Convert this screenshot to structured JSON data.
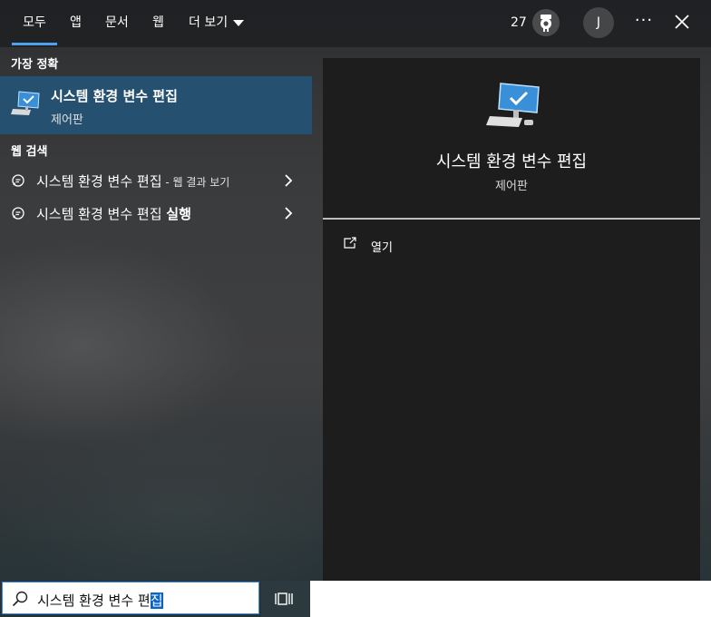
{
  "tabs": [
    {
      "label": "모두",
      "active": true
    },
    {
      "label": "앱"
    },
    {
      "label": "문서"
    },
    {
      "label": "웹"
    },
    {
      "label": "더 보기"
    }
  ],
  "header": {
    "points": "27",
    "avatar_initial": "J",
    "more_glyph": "···"
  },
  "best_match": {
    "section_title": "가장 정확",
    "name": "시스템 환경 변수 편집",
    "subtitle": "제어판",
    "icon": "monitor-check-icon"
  },
  "web": {
    "section_title": "웹 검색",
    "items": [
      {
        "text": "시스템 환경 변수 편집",
        "suffix": " - 웹 결과 보기"
      },
      {
        "text": "시스템 환경 변수 편집 ",
        "bold": "실행"
      }
    ]
  },
  "preview": {
    "name": "시스템 환경 변수 편집",
    "subtitle": "제어판",
    "actions": [
      {
        "label": "열기",
        "icon": "open-external-icon"
      }
    ]
  },
  "search": {
    "value_main": "시스템 환경 변수 편",
    "value_selected": "집"
  },
  "colors": {
    "accent": "#4ea1f0",
    "selected_row": "#25506f",
    "selection": "#0a64c6"
  }
}
